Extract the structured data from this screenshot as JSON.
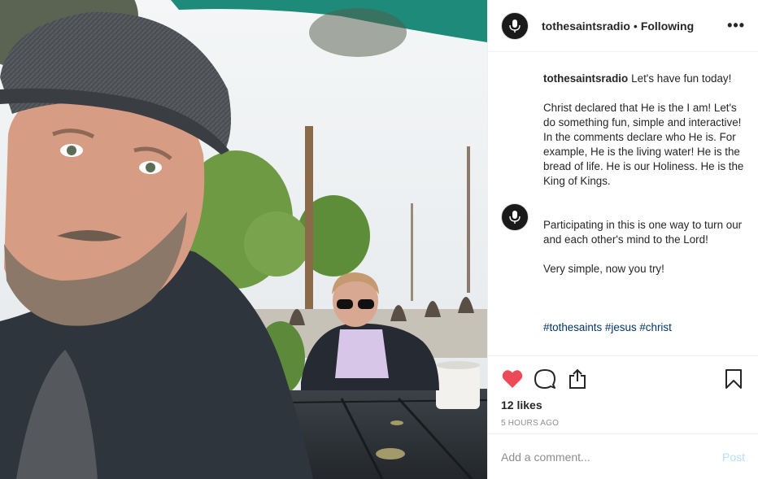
{
  "header": {
    "username": "tothesaintsradio",
    "separator": "•",
    "follow_status": "Following",
    "more_label": "•••",
    "avatar_icon": "microphone-logo-icon"
  },
  "caption": {
    "username": "tothesaintsradio",
    "text": "Let's have fun today!\n\nChrist declared that He is the I am! Let's do something fun, simple and interactive! In the comments declare who He is. For example, He is the living water! He is the bread of life. He is our Holiness. He is the King of Kings."
  },
  "comment2": {
    "text": "Participating in this is one way to turn our and each other's mind to the Lord!\n\nVery simple, now you try!",
    "hashtags": "#tothesaints #jesus #christ"
  },
  "actions": {
    "like_icon": "heart-filled-icon",
    "comment_icon": "speech-bubble-icon",
    "share_icon": "share-icon",
    "save_icon": "bookmark-icon",
    "like_color": "#ed4956"
  },
  "likes": "12 likes",
  "timestamp": "5 HOURS AGO",
  "add_comment": {
    "placeholder": "Add a comment...",
    "post_label": "Post"
  }
}
